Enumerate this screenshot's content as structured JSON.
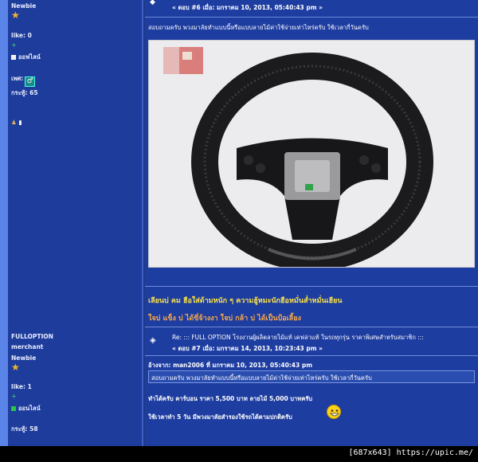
{
  "user1": {
    "rank": "Newbie",
    "like_label": "like:",
    "like_value": "0",
    "status": "ออฟไลน์",
    "gender_label": "เพศ:",
    "gender_symbol": "♂",
    "posts_label": "กระทู้:",
    "posts_value": "65"
  },
  "post6": {
    "meta": "« ตอบ #6 เมื่อ: มกราคม 10, 2013, 05:40:43 pm »",
    "body": "สอบถามครับ พวงมาลัยทำแบบนี้หรือแบบลายไม้ค่าใช้จ่ายเท่าไหร่ครับ  ใช้เวลากี่วันครับ",
    "signature_line1": "เลียนบ่ คม ฮือใส่ด้ามหนัก ๆ ความฮู้หมะนักฮือหมั่นส่ำหมั่นเฮียน",
    "signature_line2": "ใจบ่ แข็ง บ่ ได้ขี่จ้างงา ใจบ่ กล้า บ่ ได้เป็นป้อเลี้ยง"
  },
  "user2": {
    "name": "FULLOPTION",
    "role": "merchant",
    "rank": "Newbie",
    "like_label": "like:",
    "like_value": "1",
    "status": "ออนไลน์",
    "posts_label": "กระทู้:",
    "posts_value": "58"
  },
  "post7": {
    "title": "Re: ::: FULL OPTION โรงงานผู้ผลิตลายไม้แท้ เคฟล่าแท้ ในรถทุกรุ่น ราคาพิเศษสำหรับสมาชิก :::",
    "meta": "« ตอบ #7 เมื่อ: มกราคม 14, 2013, 10:23:43 pm »",
    "quote_header": "อ้างจาก: man2006 ที่ มกราคม 10, 2013, 05:40:43 pm",
    "quote_body": "สอบถามครับ พวงมาลัยทำแบบนี้หรือแบบลายไม้ค่าใช้จ่ายเท่าไหร่ครับ  ใช้เวลากี่วันครับ",
    "reply_line1": "ทำได้ครับ คาร์บอน ราคา 5,500 บาท ลายไม้ 5,000 บาทครับ",
    "reply_line2": "ใช้เวลาทำ 5 วัน มีพวงมาลัยสำรองใช้รถได้ตามปกติครับ"
  },
  "footer": {
    "text": "[687x643] https://upic.me/"
  }
}
